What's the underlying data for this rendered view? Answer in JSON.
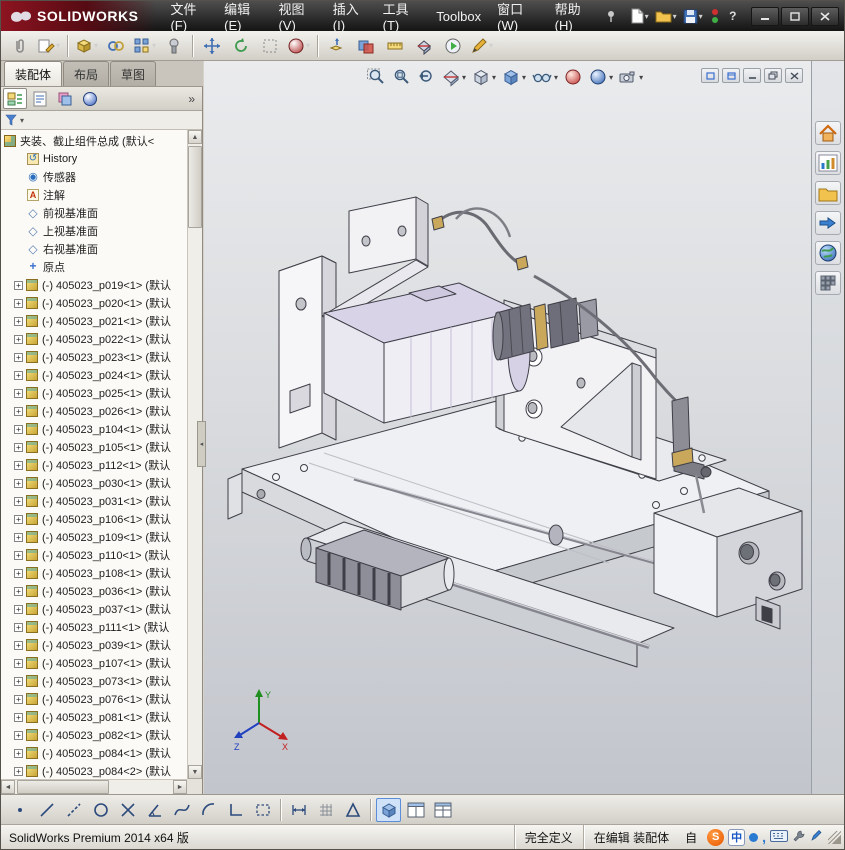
{
  "titlebar": {
    "logo_text": "SOLIDWORKS",
    "menus": [
      "文件(F)",
      "编辑(E)",
      "视图(V)",
      "插入(I)",
      "工具(T)",
      "Toolbox",
      "窗口(W)",
      "帮助(H)"
    ]
  },
  "command_tabs": {
    "items": [
      "装配体",
      "布局",
      "草图"
    ],
    "active": "装配体"
  },
  "feature_tree": {
    "root_label": "夹装、截止组件总成 (默认<",
    "folders": [
      "History",
      "传感器",
      "注解",
      "前视基准面",
      "上视基准面",
      "右视基准面",
      "原点"
    ],
    "part_prefix": "(-) ",
    "config_suffix": " (默认",
    "parts": [
      "405023_p019<1>",
      "405023_p020<1>",
      "405023_p021<1>",
      "405023_p022<1>",
      "405023_p023<1>",
      "405023_p024<1>",
      "405023_p025<1>",
      "405023_p026<1>",
      "405023_p104<1>",
      "405023_p105<1>",
      "405023_p112<1>",
      "405023_p030<1>",
      "405023_p031<1>",
      "405023_p106<1>",
      "405023_p109<1>",
      "405023_p110<1>",
      "405023_p108<1>",
      "405023_p036<1>",
      "405023_p037<1>",
      "405023_p111<1>",
      "405023_p039<1>",
      "405023_p107<1>",
      "405023_p073<1>",
      "405023_p076<1>",
      "405023_p081<1>",
      "405023_p082<1>",
      "405023_p084<1>",
      "405023_p084<2>"
    ]
  },
  "statusbar": {
    "app_version": "SolidWorks Premium 2014 x64 版",
    "define_state": "完全定义",
    "edit_state": "在编辑 装配体",
    "custom_label": "自",
    "sogou_badge": "S",
    "ime_badge": "中"
  },
  "colors": {
    "accent_blue": "#5b8dd9",
    "logo_red": "#8c1420",
    "lavender": "#d9d3e8",
    "viewport_top": "#eaebed",
    "viewport_bottom": "#c2c5cc"
  }
}
